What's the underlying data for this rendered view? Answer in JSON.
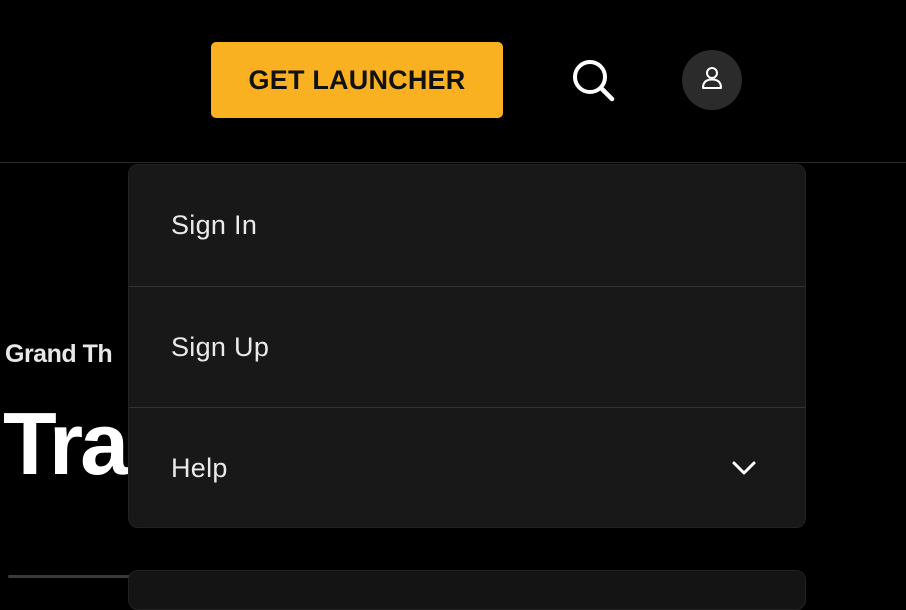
{
  "header": {
    "launcher_label": "GET LAUNCHER",
    "search_icon": "search-icon",
    "account_icon": "user-icon",
    "accent_color": "#f9b122"
  },
  "page": {
    "publisher_text": "Grand Th",
    "title_text": "Trai"
  },
  "dropdown": {
    "items": [
      {
        "label": "Sign In"
      },
      {
        "label": "Sign Up"
      },
      {
        "label": "Help",
        "icon": "chevron-down-icon"
      }
    ]
  }
}
